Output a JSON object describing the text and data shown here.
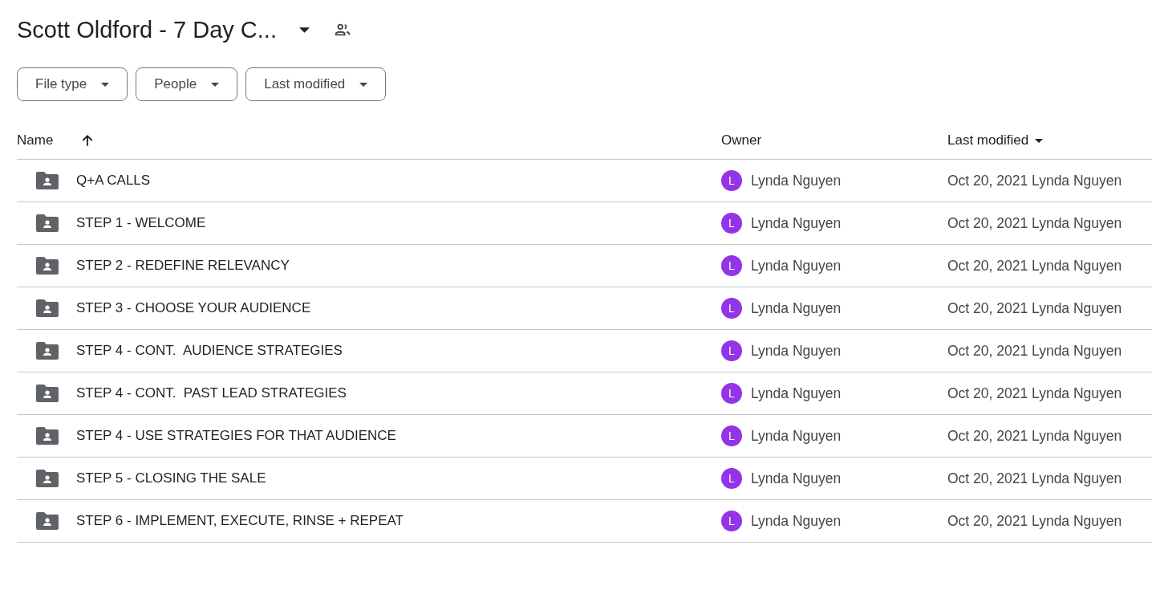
{
  "header": {
    "title": "Scott Oldford - 7 Day C..."
  },
  "filters": [
    {
      "label": "File type"
    },
    {
      "label": "People"
    },
    {
      "label": "Last modified"
    }
  ],
  "table": {
    "columns": [
      {
        "label": "Name",
        "kind": "sort-arrow"
      },
      {
        "label": "Owner",
        "kind": "plain"
      },
      {
        "label": "Last modified",
        "kind": "menu"
      }
    ],
    "rows": [
      {
        "name": "Q+A CALLS",
        "owner": "Lynda Nguyen",
        "avatar_letter": "L",
        "modified": "Oct 20, 2021 Lynda Nguyen"
      },
      {
        "name": "STEP 1 - WELCOME",
        "owner": "Lynda Nguyen",
        "avatar_letter": "L",
        "modified": "Oct 20, 2021 Lynda Nguyen"
      },
      {
        "name": "STEP 2 - REDEFINE RELEVANCY",
        "owner": "Lynda Nguyen",
        "avatar_letter": "L",
        "modified": "Oct 20, 2021 Lynda Nguyen"
      },
      {
        "name": "STEP 3 - CHOOSE YOUR AUDIENCE",
        "owner": "Lynda Nguyen",
        "avatar_letter": "L",
        "modified": "Oct 20, 2021 Lynda Nguyen"
      },
      {
        "name": "STEP 4 - CONT.  AUDIENCE STRATEGIES",
        "owner": "Lynda Nguyen",
        "avatar_letter": "L",
        "modified": "Oct 20, 2021 Lynda Nguyen"
      },
      {
        "name": "STEP 4 - CONT.  PAST LEAD STRATEGIES",
        "owner": "Lynda Nguyen",
        "avatar_letter": "L",
        "modified": "Oct 20, 2021 Lynda Nguyen"
      },
      {
        "name": "STEP 4 - USE STRATEGIES FOR THAT AUDIENCE",
        "owner": "Lynda Nguyen",
        "avatar_letter": "L",
        "modified": "Oct 20, 2021 Lynda Nguyen"
      },
      {
        "name": "STEP 5 - CLOSING THE SALE",
        "owner": "Lynda Nguyen",
        "avatar_letter": "L",
        "modified": "Oct 20, 2021 Lynda Nguyen"
      },
      {
        "name": "STEP 6 - IMPLEMENT, EXECUTE, RINSE + REPEAT",
        "owner": "Lynda Nguyen",
        "avatar_letter": "L",
        "modified": "Oct 20, 2021 Lynda Nguyen"
      }
    ]
  }
}
